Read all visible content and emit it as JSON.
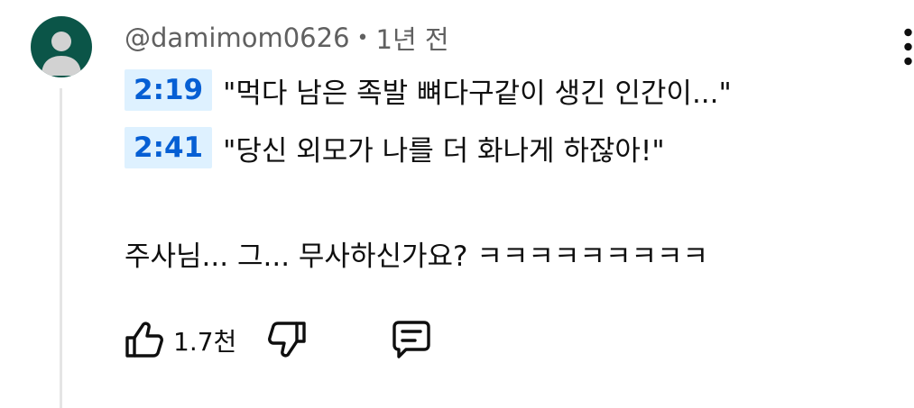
{
  "comment": {
    "author": "@damimom0626",
    "separator": "•",
    "time_ago": "1년 전",
    "lines": [
      {
        "timestamp": "2:19",
        "text": "\"먹다 남은 족발 뼈다구같이 생긴 인간이...\""
      },
      {
        "timestamp": "2:41",
        "text": "\"당신 외모가 나를 더 화나게 하잖아!\""
      }
    ],
    "body_text": "주사님... 그... 무사하신가요? ㅋㅋㅋㅋㅋㅋㅋㅋㅋ",
    "like_count": "1.7천"
  },
  "icons": {
    "avatar": "default-avatar-icon",
    "more": "more-vert-icon",
    "like": "thumb-up-icon",
    "dislike": "thumb-down-icon",
    "reply": "comment-icon"
  },
  "colors": {
    "avatar_bg": "#0b5548",
    "timestamp_bg": "#def1ff",
    "timestamp_text": "#065fd4",
    "meta_text": "#606060"
  }
}
